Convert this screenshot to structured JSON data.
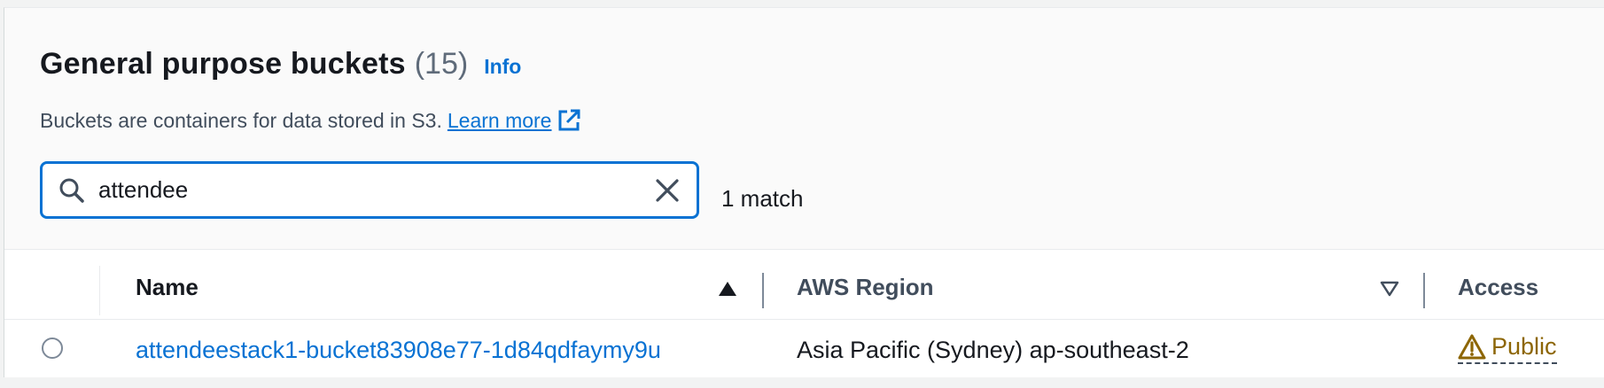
{
  "header": {
    "title": "General purpose buckets",
    "count": "(15)",
    "info_link": "Info"
  },
  "description": {
    "text": "Buckets are containers for data stored in S3.",
    "learn_more": "Learn more"
  },
  "search": {
    "value": "attendee",
    "match_count": "1 match"
  },
  "table": {
    "columns": {
      "name": "Name",
      "region": "AWS Region",
      "access": "Access"
    },
    "rows": [
      {
        "name": "attendeestack1-bucket83908e77-1d84qdfaymy9u",
        "region": "Asia Pacific (Sydney) ap-southeast-2",
        "access": "Public"
      }
    ]
  },
  "icons": {
    "search": "search-icon",
    "clear": "close-icon",
    "external": "external-link-icon",
    "sort_asc": "sort-ascending-icon",
    "sort_desc": "sort-descending-icon",
    "warning": "warning-icon"
  },
  "colors": {
    "link": "#0972d3",
    "text": "#16191f",
    "warning": "#8d6605",
    "border_focus": "#0972d3"
  }
}
